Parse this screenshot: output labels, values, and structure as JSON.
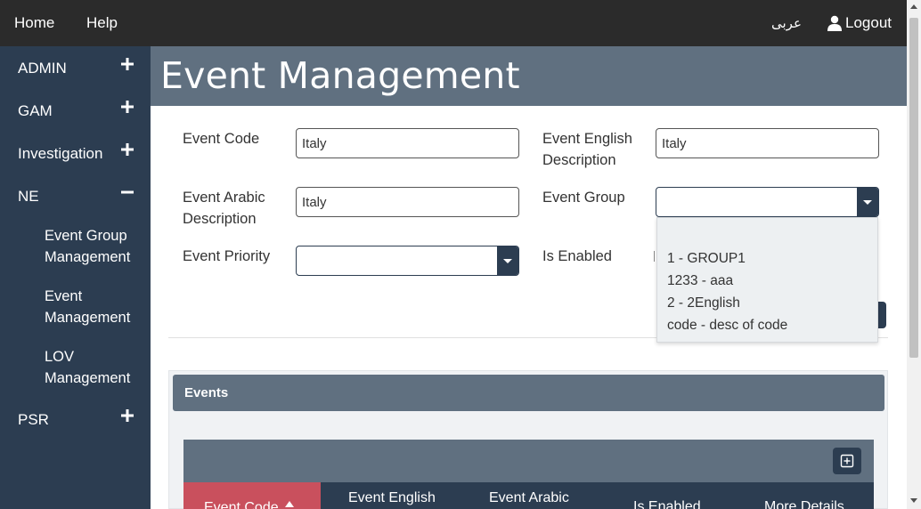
{
  "topnav": {
    "home": "Home",
    "help": "Help",
    "language": "عربى",
    "logout": "Logout"
  },
  "sidebar": {
    "items": [
      {
        "label": "ADMIN",
        "state": "collapsed"
      },
      {
        "label": "GAM",
        "state": "collapsed"
      },
      {
        "label": "Investigation",
        "state": "collapsed"
      },
      {
        "label": "NE",
        "state": "expanded"
      },
      {
        "label": "PSR",
        "state": "collapsed"
      }
    ],
    "ne_children": [
      {
        "line1": "Event Group",
        "line2": "Management"
      },
      {
        "line1": "Event",
        "line2": "Management"
      },
      {
        "line1": "LOV",
        "line2": "Management"
      }
    ]
  },
  "page": {
    "title": "Event Management"
  },
  "form": {
    "event_code": {
      "label": "Event Code",
      "value": "Italy"
    },
    "event_english_description": {
      "label_line1": "Event English",
      "label_line2": "Description",
      "value": "Italy"
    },
    "event_arabic_description": {
      "label_line1": "Event Arabic",
      "label_line2": "Description",
      "value": "Italy"
    },
    "event_group": {
      "label": "Event Group",
      "value": "",
      "options": [
        "1 - GROUP1",
        "1233 - aaa",
        "2 - 2English",
        "code - desc of code"
      ]
    },
    "event_priority": {
      "label": "Event Priority",
      "value": ""
    },
    "is_enabled": {
      "label": "Is Enabled"
    }
  },
  "events_panel": {
    "title": "Events",
    "columns": [
      "Event Code",
      "Event English",
      "Event Arabic",
      "Is Enabled",
      "More Details"
    ],
    "sorted_column": "Event Code"
  },
  "colors": {
    "topbar": "#2b2b2b",
    "sidebar": "#2c3d51",
    "header": "#607080",
    "sort_active": "#c9505d"
  }
}
